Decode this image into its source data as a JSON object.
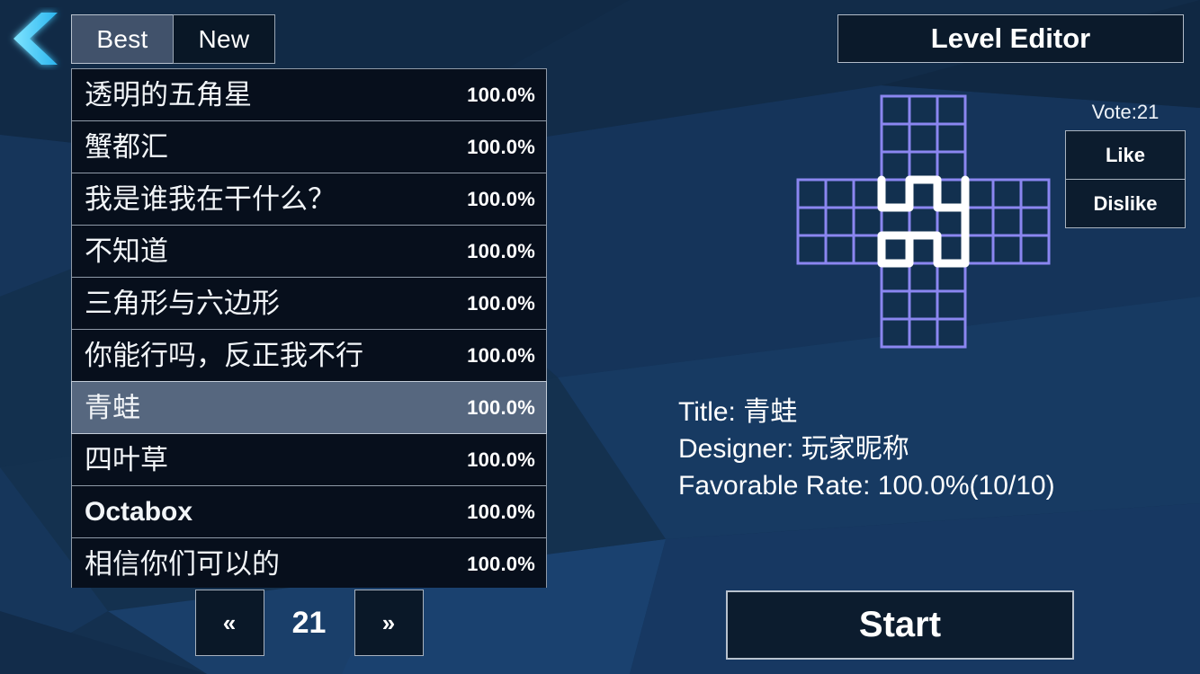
{
  "colors": {
    "background": "#14304f",
    "panel_dark": "#070f1c",
    "panel_border": "#8f9aa8",
    "selected_row": "#56677f",
    "grid_line": "#8b86f0",
    "path_line": "#ffffff",
    "back_arrow": "#45c8f5"
  },
  "nav": {
    "back_icon": "chevron-left-icon"
  },
  "tabs": [
    {
      "label": "Best",
      "active": true
    },
    {
      "label": "New",
      "active": false
    }
  ],
  "level_list": [
    {
      "name": "透明的五角星",
      "rate": "100.0%",
      "latin": false,
      "selected": false
    },
    {
      "name": "蟹都汇",
      "rate": "100.0%",
      "latin": false,
      "selected": false
    },
    {
      "name": "我是谁我在干什么？",
      "rate": "100.0%",
      "latin": false,
      "selected": false
    },
    {
      "name": "不知道",
      "rate": "100.0%",
      "latin": false,
      "selected": false
    },
    {
      "name": "三角形与六边形",
      "rate": "100.0%",
      "latin": false,
      "selected": false
    },
    {
      "name": "你能行吗，反正我不行",
      "rate": "100.0%",
      "latin": false,
      "selected": false
    },
    {
      "name": "青蛙",
      "rate": "100.0%",
      "latin": false,
      "selected": true
    },
    {
      "name": "四叶草",
      "rate": "100.0%",
      "latin": false,
      "selected": false
    },
    {
      "name": "Octabox",
      "rate": "100.0%",
      "latin": true,
      "selected": false
    },
    {
      "name": "相信你们可以的",
      "rate": "100.0%",
      "latin": false,
      "selected": false
    }
  ],
  "pager": {
    "prev_label": "«",
    "next_label": "»",
    "page": "21"
  },
  "editor": {
    "button_label": "Level Editor"
  },
  "vote": {
    "label": "Vote:21",
    "like_label": "Like",
    "dislike_label": "Dislike"
  },
  "details": {
    "title_line": "Title: 青蛙",
    "designer_line": "Designer: 玩家昵称",
    "rate_line": "Favorable Rate: 100.0%(10/10)"
  },
  "start": {
    "label": "Start"
  },
  "preview_puzzle": {
    "shape": "plus-cross",
    "cell_size": 31,
    "blocks": [
      {
        "col": 3,
        "row": 0,
        "cols": 3,
        "rows": 3
      },
      {
        "col": 0,
        "row": 3,
        "cols": 9,
        "rows": 3
      },
      {
        "col": 3,
        "row": 6,
        "cols": 3,
        "rows": 3
      }
    ],
    "path_points": [
      [
        3,
        3
      ],
      [
        3,
        4
      ],
      [
        4,
        4
      ],
      [
        4,
        3
      ],
      [
        5,
        3
      ],
      [
        5,
        4
      ],
      [
        6,
        4
      ],
      [
        6,
        3
      ],
      [
        6,
        6
      ],
      [
        5,
        6
      ],
      [
        5,
        5
      ],
      [
        4,
        5
      ],
      [
        4,
        6
      ],
      [
        3,
        6
      ],
      [
        3,
        5
      ],
      [
        4,
        5
      ]
    ]
  }
}
